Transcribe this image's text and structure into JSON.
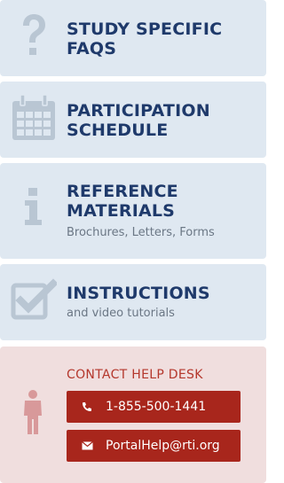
{
  "nav": {
    "items": [
      {
        "title_line1": "STUDY SPECIFIC",
        "title_line2": "FAQS",
        "subtitle": "",
        "icon": "question-mark-icon"
      },
      {
        "title_line1": "PARTICIPATION",
        "title_line2": "SCHEDULE",
        "subtitle": "",
        "icon": "calendar-icon"
      },
      {
        "title_line1": "REFERENCE",
        "title_line2": "MATERIALS",
        "subtitle": "Brochures, Letters, Forms",
        "icon": "info-icon"
      },
      {
        "title_line1": "INSTRUCTIONS",
        "title_line2": "",
        "subtitle": "and video tutorials",
        "icon": "checkbox-icon"
      }
    ]
  },
  "help": {
    "title": "CONTACT HELP DESK",
    "phone": "1-855-500-1441",
    "email": "PortalHelp@rti.org",
    "icon": "person-icon"
  },
  "colors": {
    "panel_bg": "#dfe8f1",
    "title": "#1f3a6b",
    "icon": "#b9c6d3",
    "help_bg": "#f0dede",
    "help_accent": "#b4372c",
    "button": "#a8261c"
  }
}
